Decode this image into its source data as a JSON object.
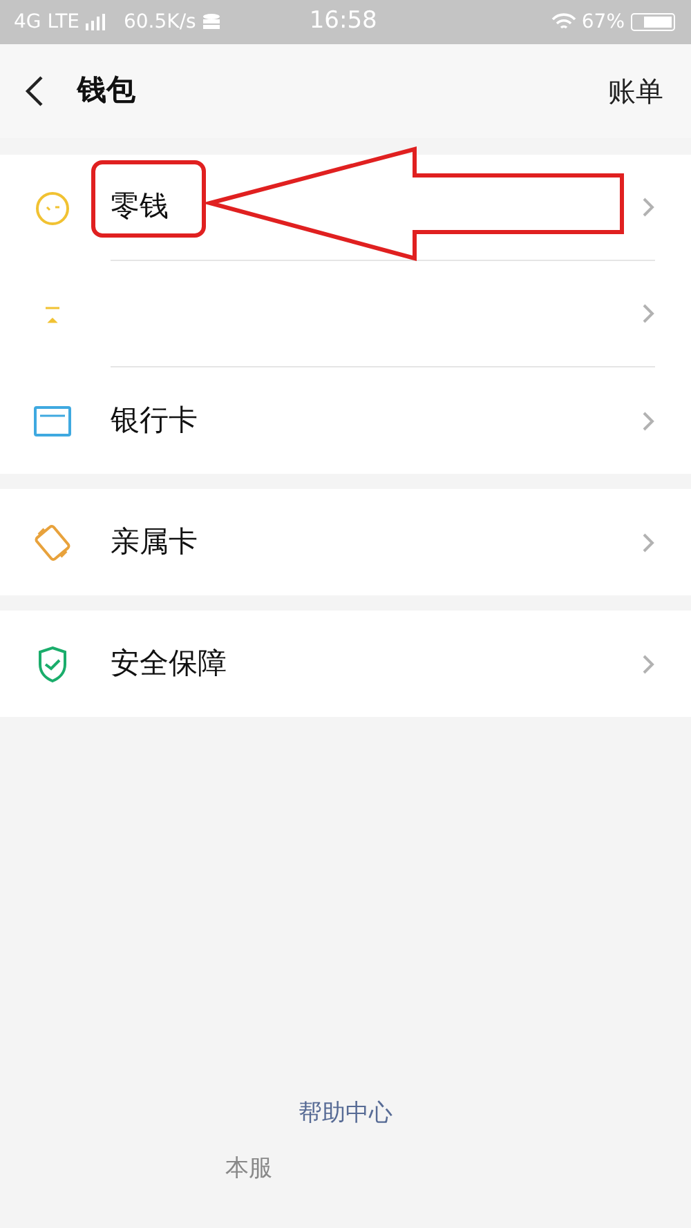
{
  "status_bar": {
    "network": "4G LTE",
    "speed": "60.5K/s",
    "time": "16:58",
    "battery": "67%"
  },
  "header": {
    "title": "钱包",
    "action": "账单"
  },
  "sections": [
    {
      "items": [
        {
          "kind": "change",
          "label": "零钱",
          "highlighted": true
        },
        {
          "kind": "fund",
          "highlighted": false
        },
        {
          "kind": "card",
          "label": "银行卡",
          "highlighted": false
        }
      ]
    },
    {
      "items": [
        {
          "kind": "family",
          "label": "亲属卡",
          "highlighted": false
        }
      ]
    },
    {
      "items": [
        {
          "kind": "security",
          "label": "安全保障",
          "highlighted": false
        }
      ]
    }
  ],
  "footer": {
    "link": "帮助中心",
    "note": "本服"
  }
}
